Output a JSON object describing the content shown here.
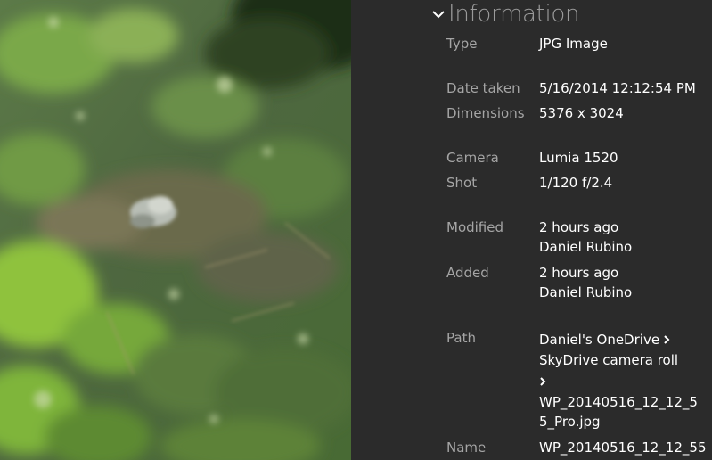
{
  "info": {
    "section_title": "Information",
    "rows": [
      {
        "label": "Type",
        "values": [
          "JPG Image"
        ]
      },
      {
        "label": "Date taken",
        "values": [
          "5/16/2014 12:12:54 PM"
        ]
      },
      {
        "label": "Dimensions",
        "values": [
          "5376 x 3024"
        ]
      },
      {
        "label": "Camera",
        "values": [
          "Lumia 1520"
        ]
      },
      {
        "label": "Shot",
        "values": [
          "1/120 f/2.4"
        ]
      },
      {
        "label": "Modified",
        "values": [
          "2 hours ago",
          "Daniel Rubino"
        ]
      },
      {
        "label": "Added",
        "values": [
          "2 hours ago",
          "Daniel Rubino"
        ]
      }
    ],
    "path": {
      "label": "Path",
      "segments": [
        "Daniel's OneDrive",
        "SkyDrive camera roll"
      ],
      "file_lines": [
        "WP_20140516_12_12_5",
        "5_Pro.jpg"
      ]
    },
    "name": {
      "label": "Name",
      "value": "WP_20140516_12_12_55"
    }
  },
  "icons": {
    "header_chevron": "chevron-down-icon",
    "path_separator": "chevron-right-icon"
  },
  "colors": {
    "panel_background": "#2b2b2b",
    "label_text": "#a5a5a5",
    "value_text": "#ffffff",
    "header_text": "#9a9a9a"
  }
}
